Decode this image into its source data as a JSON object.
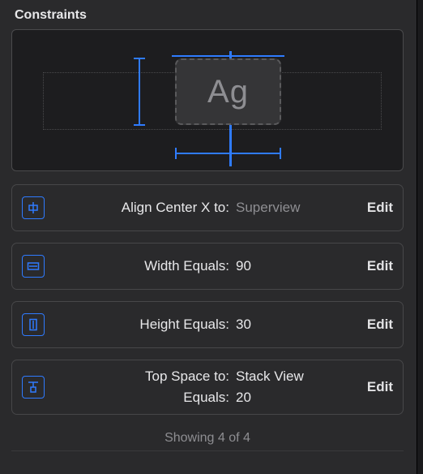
{
  "section_title": "Constraints",
  "element_glyph": "Ag",
  "constraints": [
    {
      "icon": "align-center-x-icon",
      "lines": [
        {
          "key": "Align Center X to:",
          "value": "Superview",
          "muted": true
        }
      ],
      "edit": "Edit"
    },
    {
      "icon": "width-icon",
      "lines": [
        {
          "key": "Width Equals:",
          "value": "90",
          "muted": false
        }
      ],
      "edit": "Edit"
    },
    {
      "icon": "height-icon",
      "lines": [
        {
          "key": "Height Equals:",
          "value": "30",
          "muted": false
        }
      ],
      "edit": "Edit"
    },
    {
      "icon": "top-space-icon",
      "lines": [
        {
          "key": "Top Space to:",
          "value": "Stack View",
          "muted": false
        },
        {
          "key": "Equals:",
          "value": "20",
          "muted": false
        }
      ],
      "edit": "Edit"
    }
  ],
  "footer": "Showing 4 of 4"
}
